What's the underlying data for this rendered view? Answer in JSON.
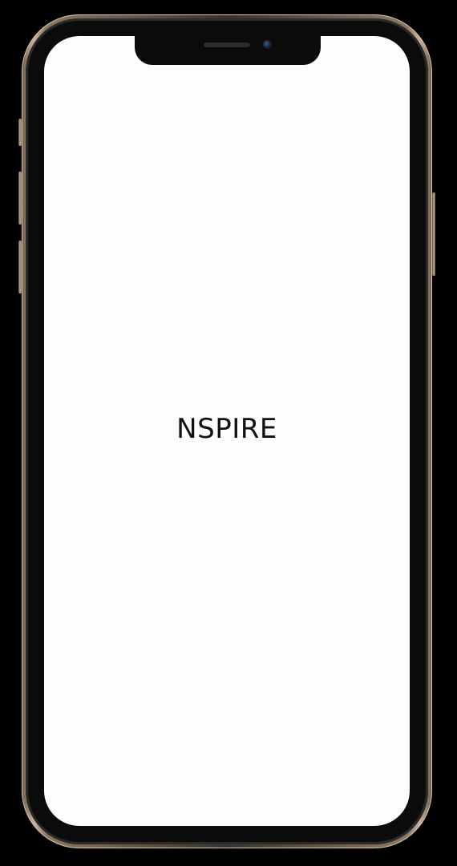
{
  "screen": {
    "title": "NSPIRE",
    "background_color": "#fdfdfd",
    "text_color": "#111111"
  },
  "device": {
    "frame_color": "#c9b49a",
    "bezel_color": "#0b0b0b"
  },
  "icons": {
    "camera": "front-camera-icon",
    "speaker": "earpiece-speaker-icon"
  }
}
